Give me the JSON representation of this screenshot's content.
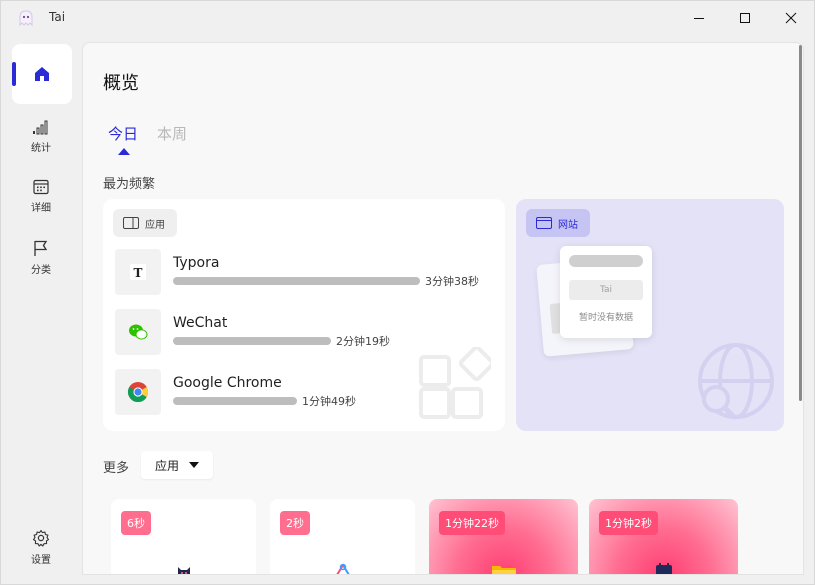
{
  "window": {
    "title": "Tai"
  },
  "nav": {
    "items": [
      {
        "label": "统计",
        "icon": "signal-bars-icon"
      },
      {
        "label": "详细",
        "icon": "calendar-icon"
      },
      {
        "label": "分类",
        "icon": "flag-icon"
      }
    ],
    "settings_label": "设置"
  },
  "overview": {
    "title": "概览",
    "tabs": [
      "今日",
      "本周"
    ],
    "active_tab": "今日",
    "most_frequent_label": "最为频繁"
  },
  "apps_card": {
    "chip_label": "应用",
    "items": [
      {
        "name": "Typora",
        "time": "3分钟38秒",
        "share": 1.0
      },
      {
        "name": "WeChat",
        "time": "2分钟19秒",
        "share": 0.64
      },
      {
        "name": "Google Chrome",
        "time": "1分钟49秒",
        "share": 0.5
      }
    ]
  },
  "web_card": {
    "chip_label": "网站",
    "placeholder_button": "Tai",
    "empty_text": "暂时没有数据"
  },
  "more": {
    "label": "更多",
    "select_value": "应用"
  },
  "tiles": [
    {
      "time": "6秒",
      "style": "white"
    },
    {
      "time": "2秒",
      "style": "white"
    },
    {
      "time": "1分钟22秒",
      "style": "pink"
    },
    {
      "time": "1分钟2秒",
      "style": "pink"
    }
  ],
  "colors": {
    "accent": "#2a2bd6",
    "tile_pink": "#ff4d77",
    "web_card_bg": "#e3e2f6"
  }
}
